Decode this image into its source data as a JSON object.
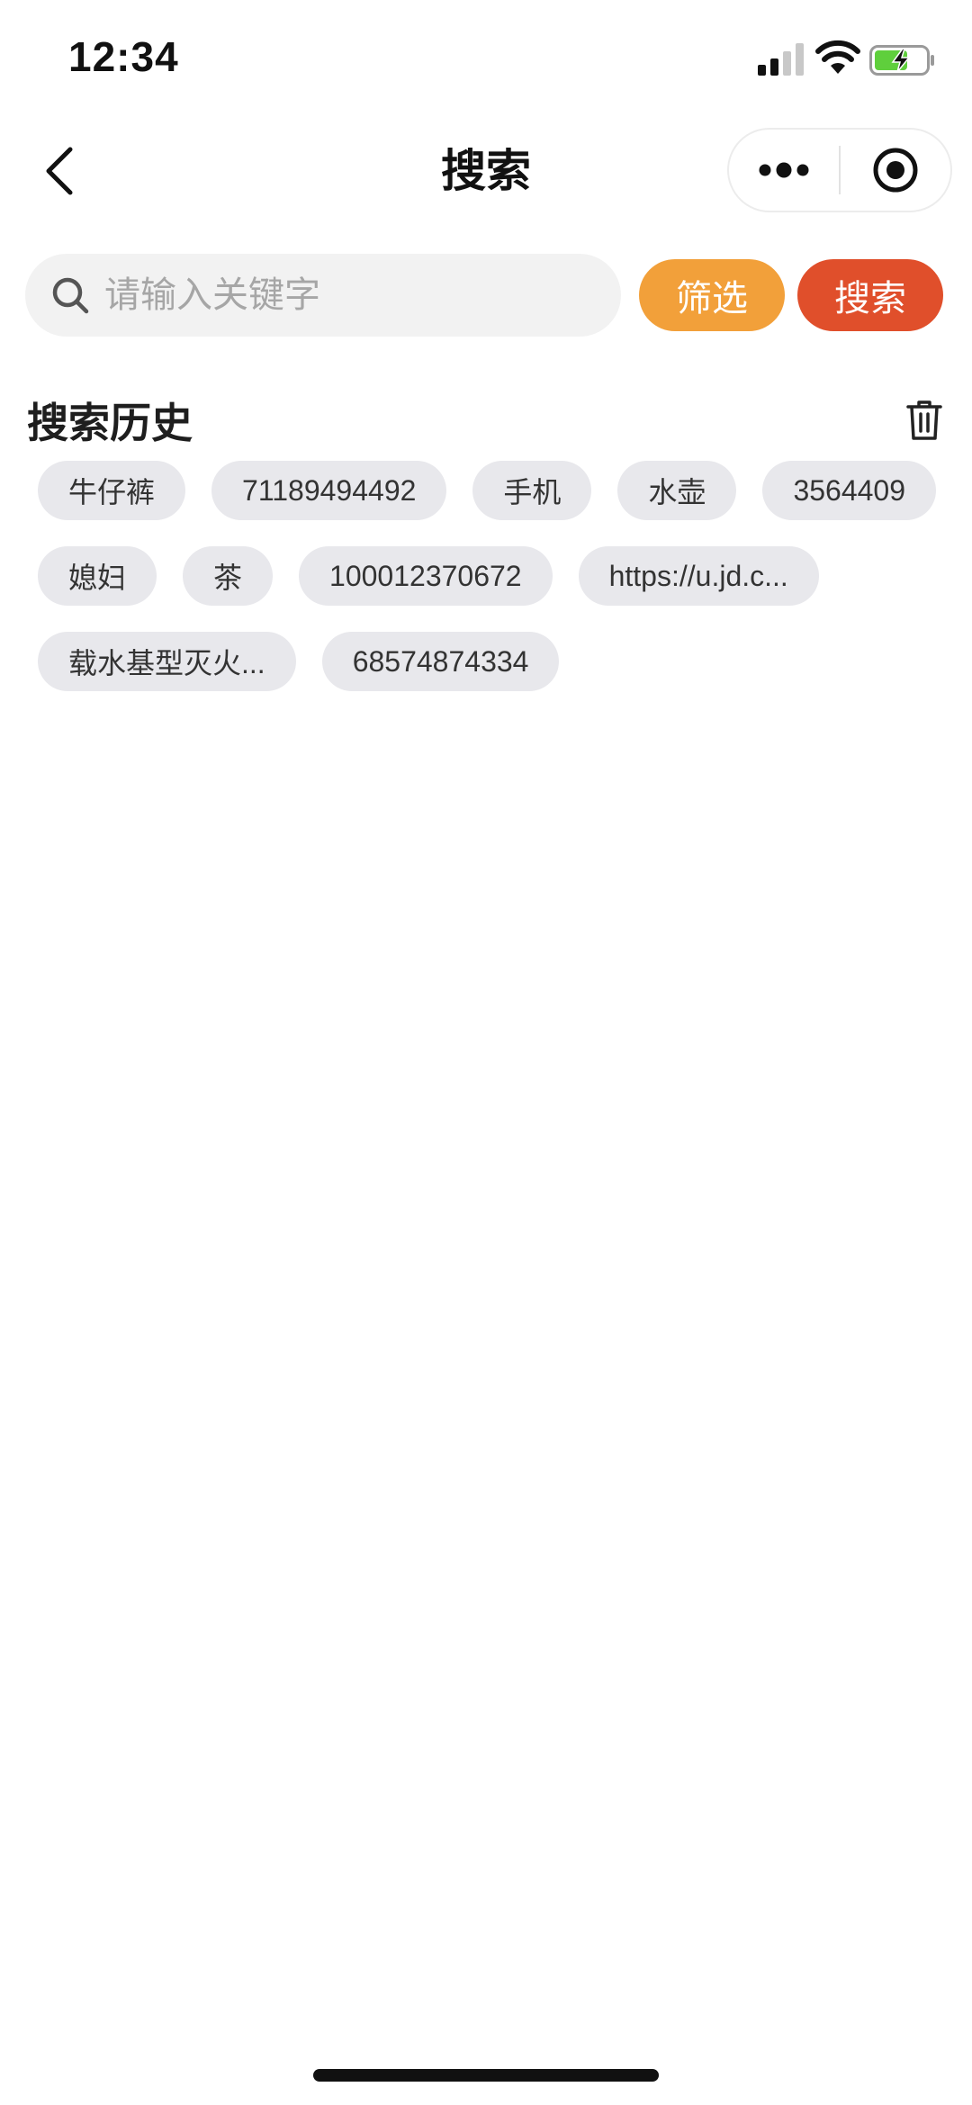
{
  "status_bar": {
    "time": "12:34",
    "icons": [
      "cellular-signal-icon",
      "wifi-icon",
      "battery-charging-icon"
    ],
    "battery_color": "#5fcf3c"
  },
  "nav": {
    "title": "搜索",
    "back_icon": "chevron-left-icon",
    "capsule_icons": [
      "more-dots-icon",
      "target-close-icon"
    ]
  },
  "search": {
    "placeholder": "请输入关键字",
    "value": "",
    "filter_label": "筛选",
    "search_label": "搜索",
    "filter_color": "#f2a03a",
    "search_color": "#e04f2b"
  },
  "history": {
    "title": "搜索历史",
    "clear_icon": "trash-icon",
    "tags": [
      "牛仔裤",
      "71189494492",
      "手机",
      "水壶",
      "3564409",
      "媳妇",
      "茶",
      "100012370672",
      "https://u.jd.c...",
      "载水基型灭火...",
      "68574874334"
    ]
  }
}
